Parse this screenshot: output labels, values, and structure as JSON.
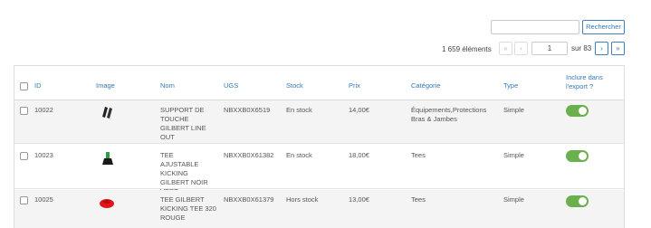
{
  "search": {
    "value": "",
    "button_label": "Rechercher"
  },
  "pager": {
    "count_label": "1 659 éléments",
    "first": "«",
    "prev": "‹",
    "current_page": "1",
    "of_label": "sur 83",
    "next": "›",
    "last": "»"
  },
  "table": {
    "headers": {
      "id": "ID",
      "image": "Image",
      "name": "Nom",
      "sku": "UGS",
      "stock": "Stock",
      "price": "Prix",
      "category": "Catégorie",
      "type": "Type",
      "include": "Inclure dans l'export ?"
    },
    "rows": [
      {
        "id": "10022",
        "image_icon": "gloves-product-icon",
        "name": "SUPPORT DE TOUCHE GILBERT LINE OUT",
        "sku": "NBXXB0X6519",
        "stock": "En stock",
        "price": "14,00€",
        "category": "Équipements,Protections Bras & Jambes",
        "type": "Simple",
        "include": true
      },
      {
        "id": "10023",
        "image_icon": "kicking-tee-green-icon",
        "name": "TEE AJUSTABLE KICKING GILBERT NOIR VERT",
        "sku": "NBXXB0X61382",
        "stock": "En stock",
        "price": "18,00€",
        "category": "Tees",
        "type": "Simple",
        "include": true
      },
      {
        "id": "10025",
        "image_icon": "kicking-tee-red-icon",
        "name": "TEE GILBERT KICKING TEE 320 ROUGE",
        "sku": "NBXXB0X61379",
        "stock": "Hors stock",
        "price": "13,00€",
        "category": "Tees",
        "type": "Simple",
        "include": true
      }
    ]
  },
  "colors": {
    "accent": "#337ab7",
    "toggle_on": "#6ab04c"
  }
}
